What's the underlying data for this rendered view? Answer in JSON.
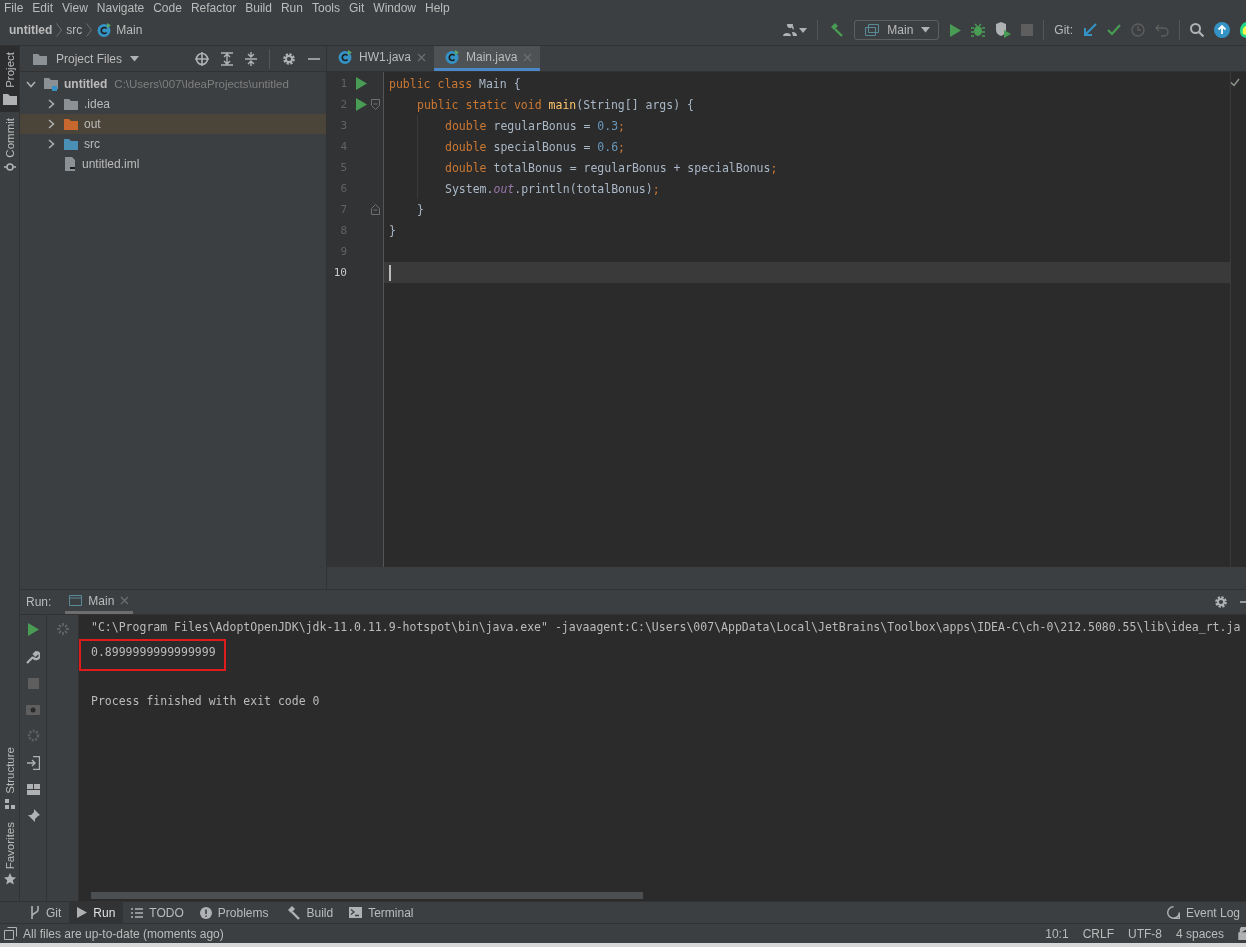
{
  "menu_bar": [
    "File",
    "Edit",
    "View",
    "Navigate",
    "Code",
    "Refactor",
    "Build",
    "Run",
    "Tools",
    "Git",
    "Window",
    "Help"
  ],
  "breadcrumbs": [
    {
      "label": "untitled",
      "kind": "project"
    },
    {
      "label": "src",
      "kind": "folder"
    },
    {
      "label": "Main",
      "kind": "class"
    }
  ],
  "toolbar": {
    "run_configuration": "Main",
    "git_label": "Git:"
  },
  "left_strip": [
    {
      "label": "Project",
      "kind": "project",
      "selected": true
    },
    {
      "label": "Commit",
      "kind": "commit",
      "selected": false
    }
  ],
  "left_strip_bottom": [
    {
      "label": "Structure",
      "kind": "structure"
    },
    {
      "label": "Favorites",
      "kind": "favorites"
    }
  ],
  "project_panel": {
    "title": "Project Files",
    "tree": [
      {
        "name": "untitled",
        "kind": "module",
        "path": "C:\\Users\\007\\IdeaProjects\\untitled",
        "expanded": true,
        "selected": false,
        "children": [
          {
            "name": ".idea",
            "kind": "folder",
            "color": "#8c9195",
            "expanded": false,
            "selected": false
          },
          {
            "name": "out",
            "kind": "folder",
            "color": "#c8682f",
            "expanded": false,
            "selected": true
          },
          {
            "name": "src",
            "kind": "folder",
            "color": "#4a8fb5",
            "expanded": false,
            "selected": false
          },
          {
            "name": "untitled.iml",
            "kind": "file",
            "selected": false
          }
        ]
      }
    ]
  },
  "editor": {
    "tabs": [
      {
        "label": "HW1.java",
        "selected": false
      },
      {
        "label": "Main.java",
        "selected": true
      }
    ],
    "lines": [
      {
        "number": "1",
        "run": true,
        "fold_start": false,
        "fold_end": false,
        "current": false,
        "tokens": [
          {
            "kind": "keyword",
            "text": "public class "
          },
          {
            "kind": "plain",
            "text": "Main {"
          }
        ],
        "children": [
          {
            "number": "2",
            "run": true,
            "fold_start": true,
            "fold_end": false,
            "current": false,
            "tokens": [
              {
                "kind": "keyword",
                "text": "public static void "
              },
              {
                "kind": "method",
                "text": "main"
              },
              {
                "kind": "plain",
                "text": "(String[] args) {"
              }
            ],
            "children": [
              {
                "number": "3",
                "run": false,
                "fold_start": false,
                "fold_end": false,
                "current": false,
                "tokens": [
                  {
                    "kind": "keyword",
                    "text": "double "
                  },
                  {
                    "kind": "plain",
                    "text": "regularBonus = "
                  },
                  {
                    "kind": "number",
                    "text": "0.3"
                  },
                  {
                    "kind": "punct",
                    "text": ";"
                  }
                ]
              },
              {
                "number": "4",
                "run": false,
                "fold_start": false,
                "fold_end": false,
                "current": false,
                "tokens": [
                  {
                    "kind": "keyword",
                    "text": "double "
                  },
                  {
                    "kind": "plain",
                    "text": "specialBonus = "
                  },
                  {
                    "kind": "number",
                    "text": "0.6"
                  },
                  {
                    "kind": "punct",
                    "text": ";"
                  }
                ]
              },
              {
                "number": "5",
                "run": false,
                "fold_start": false,
                "fold_end": false,
                "current": false,
                "tokens": [
                  {
                    "kind": "keyword",
                    "text": "double "
                  },
                  {
                    "kind": "plain",
                    "text": "totalBonus = regularBonus + specialBonus"
                  },
                  {
                    "kind": "punct",
                    "text": ";"
                  }
                ]
              },
              {
                "number": "6",
                "run": false,
                "fold_start": false,
                "fold_end": false,
                "current": false,
                "tokens": [
                  {
                    "kind": "plain",
                    "text": "System."
                  },
                  {
                    "kind": "field",
                    "text": "out"
                  },
                  {
                    "kind": "plain",
                    "text": ".println(totalBonus)"
                  },
                  {
                    "kind": "punct",
                    "text": ";"
                  }
                ]
              }
            ]
          },
          {
            "number": "7",
            "run": false,
            "fold_start": false,
            "fold_end": true,
            "current": false,
            "tokens": [
              {
                "kind": "plain",
                "text": "}"
              }
            ]
          }
        ]
      },
      {
        "number": "8",
        "run": false,
        "fold_start": false,
        "fold_end": false,
        "current": false,
        "tokens": [
          {
            "kind": "plain",
            "text": "}"
          }
        ]
      },
      {
        "number": "9",
        "run": false,
        "fold_start": false,
        "fold_end": false,
        "current": false
      },
      {
        "number": "10",
        "run": false,
        "fold_start": false,
        "fold_end": false,
        "current": true
      }
    ]
  },
  "run_panel": {
    "label": "Run:",
    "tab": "Main",
    "output": [
      {
        "kind": "command",
        "highlighted": false,
        "text": "\"C:\\Program Files\\AdoptOpenJDK\\jdk-11.0.11.9-hotspot\\bin\\java.exe\" -javaagent:C:\\Users\\007\\AppData\\Local\\JetBrains\\Toolbox\\apps\\IDEA-C\\ch-0\\212.5080.55\\lib\\idea_rt.ja"
      },
      {
        "kind": "output",
        "highlighted": true,
        "text": "0.8999999999999999"
      },
      {
        "kind": "exit",
        "highlighted": false,
        "text": "Process finished with exit code 0"
      }
    ]
  },
  "bottom_tabs": [
    {
      "label": "Git",
      "kind": "git",
      "selected": false
    },
    {
      "label": "Run",
      "kind": "run",
      "selected": true
    },
    {
      "label": "TODO",
      "kind": "todo",
      "selected": false
    },
    {
      "label": "Problems",
      "kind": "problems",
      "selected": false
    },
    {
      "label": "Build",
      "kind": "build",
      "selected": false
    },
    {
      "label": "Terminal",
      "kind": "terminal",
      "selected": false
    }
  ],
  "event_log": "Event Log",
  "status_bar": {
    "message": "All files are up-to-date (moments ago)",
    "items": [
      "10:1",
      "CRLF",
      "UTF-8",
      "4 spaces"
    ]
  }
}
